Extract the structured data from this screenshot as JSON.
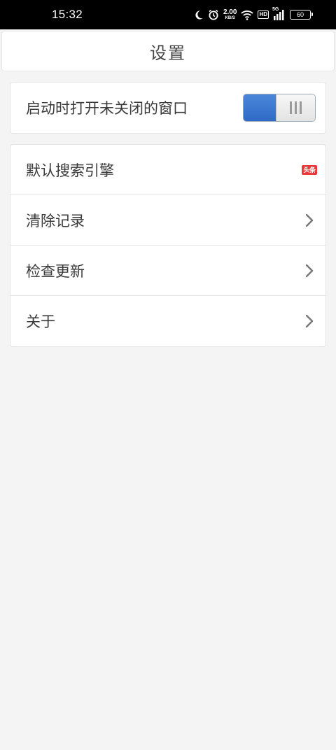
{
  "status_bar": {
    "time": "15:32",
    "net_speed_value": "2.00",
    "net_speed_unit": "KB/S",
    "hd_label": "HD",
    "network_label": "5G",
    "battery_level": "60",
    "icons": [
      "moon-icon",
      "alarm-icon",
      "wifi-icon",
      "signal-icon",
      "battery-icon"
    ]
  },
  "header": {
    "title": "设置"
  },
  "toggle_setting": {
    "label": "启动时打开未关闭的窗口",
    "state": "on",
    "accent_color": "#3a78d0"
  },
  "menu": {
    "items": [
      {
        "label": "默认搜索引擎",
        "trailing": "engine-badge",
        "badge_text": "头条",
        "badge_color": "#e8383c"
      },
      {
        "label": "清除记录",
        "trailing": "chevron-right-icon"
      },
      {
        "label": "检查更新",
        "trailing": "chevron-right-icon"
      },
      {
        "label": "关于",
        "trailing": "chevron-right-icon"
      }
    ]
  }
}
